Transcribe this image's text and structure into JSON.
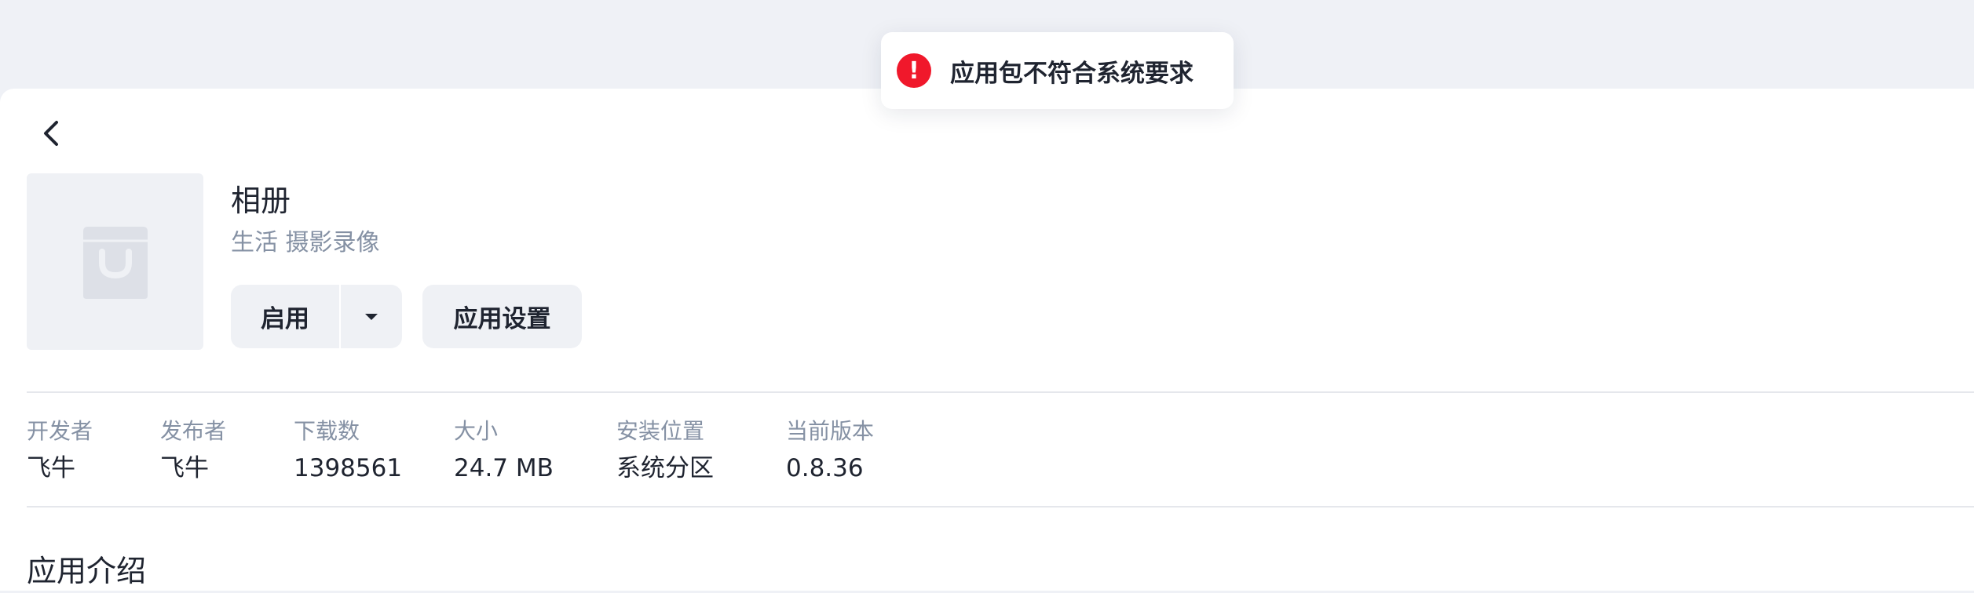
{
  "toast": {
    "message": "应用包不符合系统要求",
    "icon": "error-icon",
    "icon_glyph": "!",
    "color": "#f0182b"
  },
  "nav": {
    "back_icon": "chevron-left-icon"
  },
  "app": {
    "icon": "shopping-bag-icon",
    "name": "相册",
    "categories": "生活 摄影录像"
  },
  "actions": {
    "enable_label": "启用",
    "dropdown_icon": "caret-down-icon",
    "settings_label": "应用设置"
  },
  "stats": [
    {
      "label": "开发者",
      "value": "飞牛"
    },
    {
      "label": "发布者",
      "value": "飞牛"
    },
    {
      "label": "下载数",
      "value": "1398561"
    },
    {
      "label": "大小",
      "value": "24.7 MB"
    },
    {
      "label": "安装位置",
      "value": "系统分区"
    },
    {
      "label": "当前版本",
      "value": "0.8.36"
    }
  ],
  "section": {
    "intro_title": "应用介绍"
  }
}
